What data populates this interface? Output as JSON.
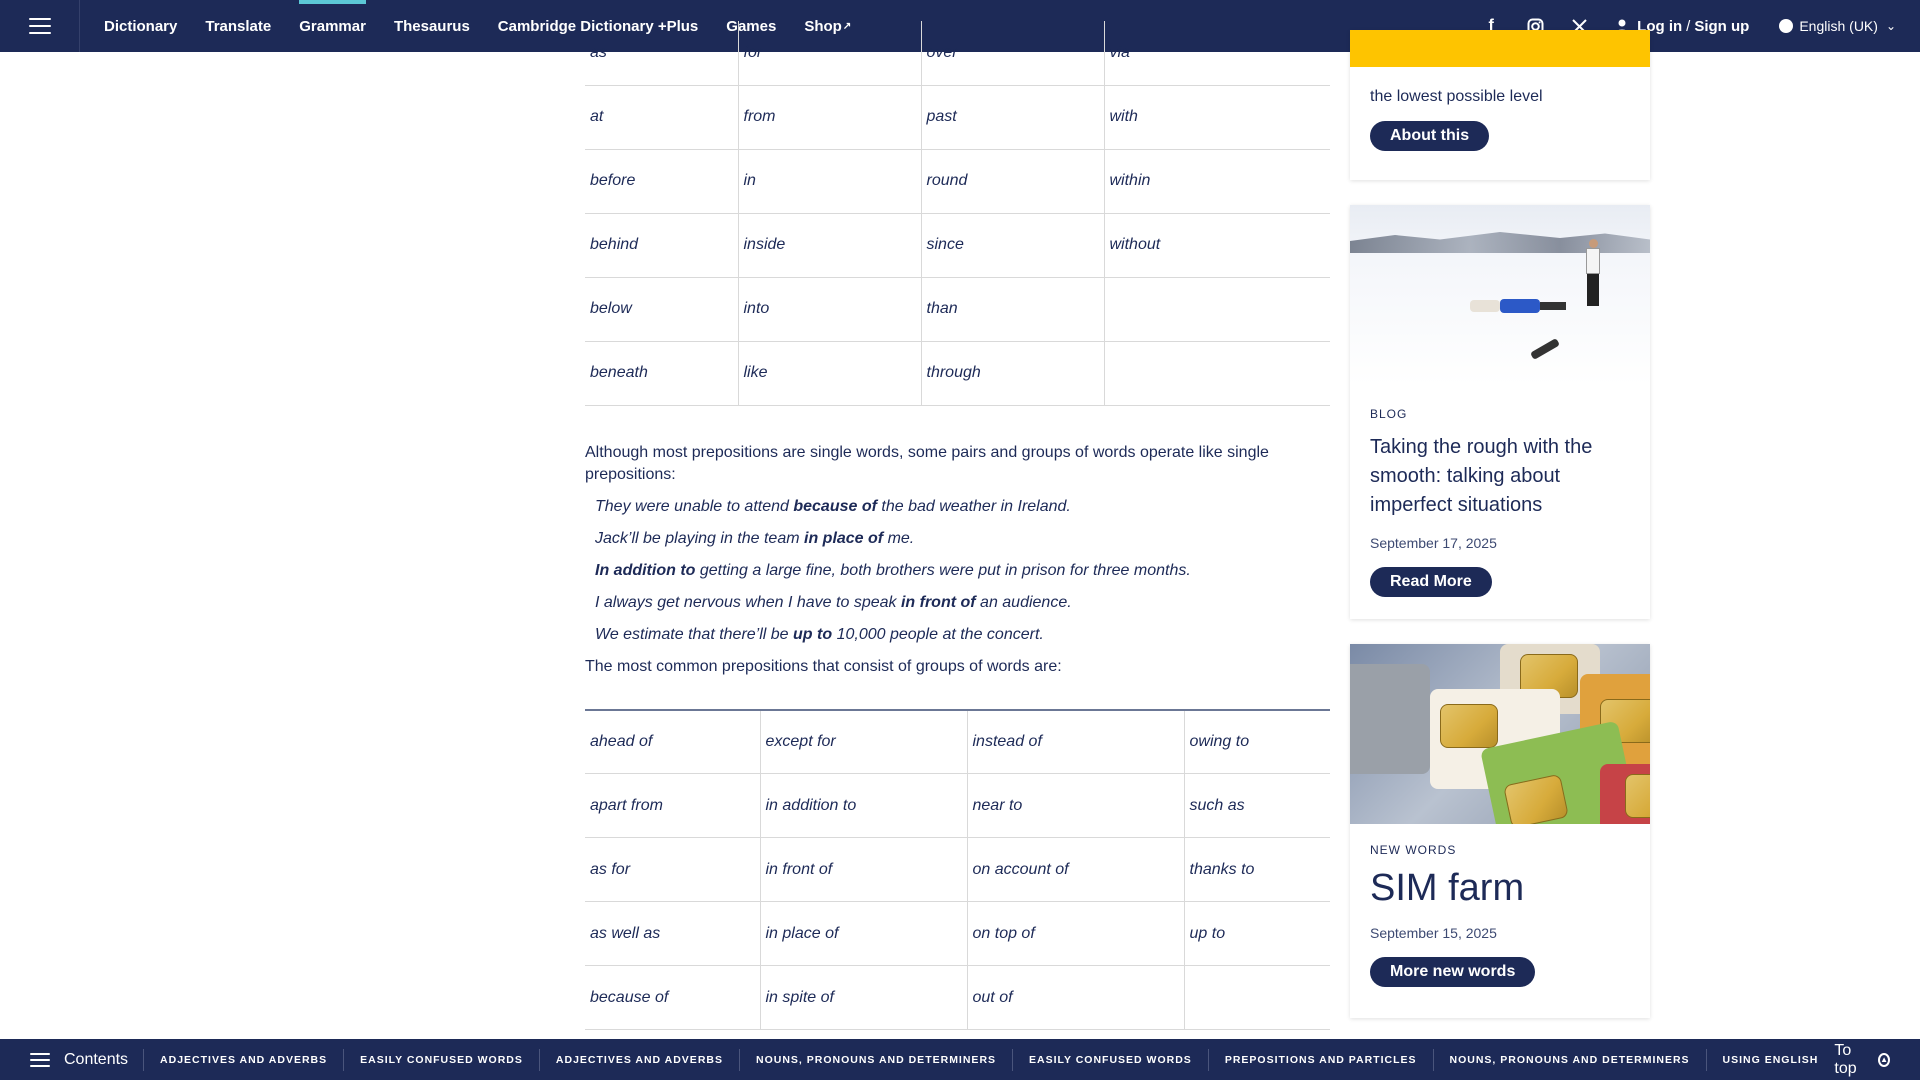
{
  "nav": {
    "links": [
      "Dictionary",
      "Translate",
      "Grammar",
      "Thesaurus",
      "Cambridge Dictionary +Plus",
      "Games",
      "Shop"
    ],
    "active": "Grammar",
    "login": "Log in",
    "signup": "Sign up",
    "language": "English (UK)",
    "social": [
      "facebook-icon",
      "instagram-icon",
      "x-icon"
    ]
  },
  "main": {
    "table1": [
      [
        "as",
        "for",
        "over",
        "via"
      ],
      [
        "at",
        "from",
        "past",
        "with"
      ],
      [
        "before",
        "in",
        "round",
        "within"
      ],
      [
        "behind",
        "inside",
        "since",
        "without"
      ],
      [
        "below",
        "into",
        "than",
        ""
      ],
      [
        "beneath",
        "like",
        "through",
        ""
      ]
    ],
    "intro": "Although most prepositions are single words, some pairs and groups of words operate like single prepositions:",
    "examples": [
      {
        "pre": "They were unable to attend ",
        "bold": "because of",
        "post": " the bad weather in Ireland."
      },
      {
        "pre": "Jack’ll be playing in the team ",
        "bold": "in place of",
        "post": " me."
      },
      {
        "pre": "",
        "bold": "In addition to",
        "post": " getting a large fine, both brothers were put in prison for three months."
      },
      {
        "pre": "I always get nervous when I have to speak ",
        "bold": "in front of",
        "post": " an audience."
      },
      {
        "pre": "We estimate that there’ll be ",
        "bold": "up to",
        "post": " 10,000 people at the concert."
      }
    ],
    "groups_intro": "The most common prepositions that consist of groups of words are:",
    "table2": [
      [
        "ahead of",
        "except for",
        "instead of",
        "owing to"
      ],
      [
        "apart from",
        "in addition to",
        "near to",
        "such as"
      ],
      [
        "as for",
        "in front of",
        "on account of",
        "thanks to"
      ],
      [
        "as well as",
        "in place of",
        "on top of",
        "up to"
      ],
      [
        "because of",
        "in spite of",
        "out of",
        ""
      ]
    ]
  },
  "sidebar": {
    "word_card": {
      "desc": "the lowest possible level",
      "button": "About this"
    },
    "blog_card": {
      "kicker": "BLOG",
      "title": "Taking the rough with the smooth: talking about imperfect situations",
      "date": "September 17, 2025",
      "button": "Read More"
    },
    "newwords_card": {
      "kicker": "NEW WORDS",
      "title": "SIM farm",
      "date": "September 15, 2025",
      "button": "More new words"
    }
  },
  "bottombar": {
    "contents": "Contents",
    "tags": [
      "ADJECTIVES AND ADVERBS",
      "EASILY CONFUSED WORDS",
      "ADJECTIVES AND ADVERBS",
      "NOUNS, PRONOUNS AND DETERMINERS",
      "EASILY CONFUSED WORDS",
      "PREPOSITIONS AND PARTICLES",
      "NOUNS, PRONOUNS AND DETERMINERS",
      "USING ENGLISH"
    ],
    "totop": "To top"
  },
  "colors": {
    "navy": "#1d2a57",
    "accent": "#5cc8d6",
    "yellow": "#fec400"
  }
}
